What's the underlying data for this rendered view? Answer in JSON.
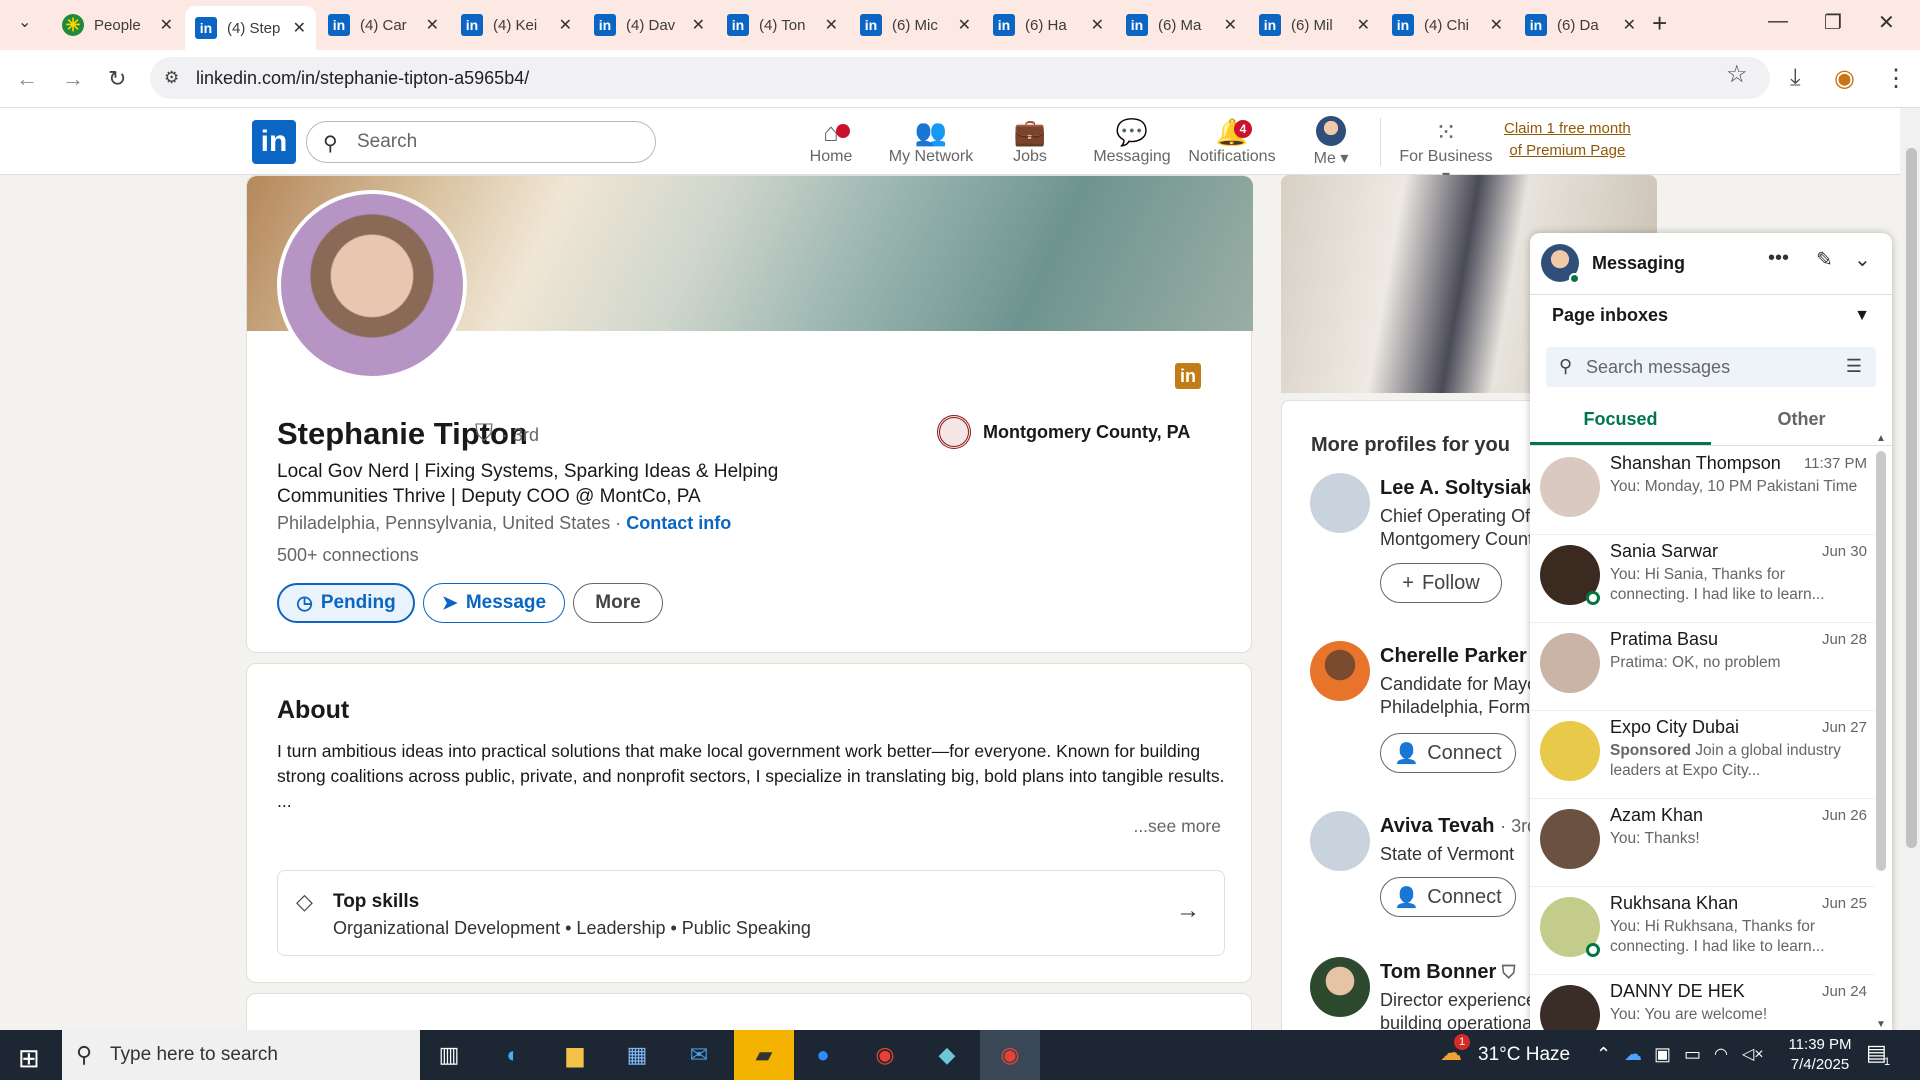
{
  "browser": {
    "tabs": [
      {
        "label": "People",
        "icon": "people-icon"
      },
      {
        "label": "(4) Step",
        "icon": "linkedin-icon"
      },
      {
        "label": "(4) Car",
        "icon": "linkedin-icon"
      },
      {
        "label": "(4) Kei",
        "icon": "linkedin-icon"
      },
      {
        "label": "(4) Dav",
        "icon": "linkedin-icon"
      },
      {
        "label": "(4) Ton",
        "icon": "linkedin-icon"
      },
      {
        "label": "(6) Mic",
        "icon": "linkedin-icon"
      },
      {
        "label": "(6) Ha",
        "icon": "linkedin-icon"
      },
      {
        "label": "(6) Ma",
        "icon": "linkedin-icon"
      },
      {
        "label": "(6) Mil",
        "icon": "linkedin-icon"
      },
      {
        "label": "(4) Chi",
        "icon": "linkedin-icon"
      },
      {
        "label": "(6) Da",
        "icon": "linkedin-icon"
      }
    ],
    "url": "linkedin.com/in/stephanie-tipton-a5965b4/"
  },
  "linkedin_header": {
    "search_placeholder": "Search",
    "nav": [
      {
        "label": "Home",
        "badge": ""
      },
      {
        "label": "My Network",
        "badge": ""
      },
      {
        "label": "Jobs",
        "badge": ""
      },
      {
        "label": "Messaging",
        "badge": ""
      },
      {
        "label": "Notifications",
        "badge": "4"
      },
      {
        "label": "Me",
        "badge": ""
      },
      {
        "label": "For Business",
        "badge": ""
      }
    ],
    "premium_line1": "Claim 1 free month",
    "premium_line2": "of Premium Page"
  },
  "profile": {
    "name": "Stephanie Tipton",
    "degree": "· 3rd",
    "headline": "Local Gov Nerd | Fixing Systems, Sparking Ideas & Helping Communities Thrive | Deputy COO @ MontCo, PA",
    "location": "Philadelphia, Pennsylvania, United States ·",
    "contact_info": "Contact info",
    "connections": "500+ connections",
    "org": "Montgomery County, PA",
    "buttons": {
      "pending": "Pending",
      "message": "Message",
      "more": "More"
    }
  },
  "about": {
    "title": "About",
    "text": "I turn ambitious ideas into practical solutions that make local government work better—for everyone. Known for building strong coalitions across public, private, and nonprofit sectors, I specialize in translating big, bold plans into tangible results.",
    "ellipsis": "...",
    "see_more": "...see more",
    "top_skills_title": "Top skills",
    "top_skills": "Organizational Development • Leadership • Public Speaking"
  },
  "more_profiles": {
    "title": "More profiles for you",
    "people": [
      {
        "name": "Lee A. Soltysiak",
        "desc1": "Chief Operating Off",
        "desc2": "Montgomery Count",
        "button": "Follow"
      },
      {
        "name": "Cherelle Parker",
        "desc1": "Candidate for Mayo",
        "desc2": "Philadelphia, Forme",
        "button": "Connect"
      },
      {
        "name": "Aviva Tevah",
        "degree": "· 3rd",
        "desc1": "State of Vermont",
        "desc2": "",
        "button": "Connect"
      },
      {
        "name": "Tom Bonner",
        "desc1": "Director experience",
        "desc2": "building operationa",
        "button": ""
      }
    ]
  },
  "messaging": {
    "title": "Messaging",
    "inbox_selector": "Page inboxes",
    "search_placeholder": "Search messages",
    "tabs": [
      "Focused",
      "Other"
    ],
    "conversations": [
      {
        "name": "Shanshan Thompson",
        "date": "11:37 PM",
        "snippet": "You: Monday, 10 PM Pakistani Time",
        "online": false,
        "sponsored": ""
      },
      {
        "name": "Sania Sarwar",
        "date": "Jun 30",
        "snippet": "You: Hi Sania, Thanks for connecting. I had like to learn...",
        "online": true,
        "sponsored": ""
      },
      {
        "name": "Pratima Basu",
        "date": "Jun 28",
        "snippet": "Pratima: OK, no problem",
        "online": false,
        "sponsored": ""
      },
      {
        "name": "Expo City Dubai",
        "date": "Jun 27",
        "snippet": "Join a global industry leaders at Expo City...",
        "online": false,
        "sponsored": "Sponsored"
      },
      {
        "name": "Azam Khan",
        "date": "Jun 26",
        "snippet": "You: Thanks!",
        "online": false,
        "sponsored": ""
      },
      {
        "name": "Rukhsana Khan",
        "date": "Jun 25",
        "snippet": "You: Hi Rukhsana, Thanks for connecting. I had like to learn...",
        "online": true,
        "sponsored": ""
      },
      {
        "name": "DANNY DE HEK",
        "date": "Jun 24",
        "snippet": "You: You are welcome!",
        "online": false,
        "sponsored": ""
      }
    ]
  },
  "taskbar": {
    "search_placeholder": "Type here to search",
    "weather": "31°C Haze",
    "weather_badge": "1",
    "time": "11:39 PM",
    "date": "7/4/2025",
    "notification_count": "1"
  }
}
